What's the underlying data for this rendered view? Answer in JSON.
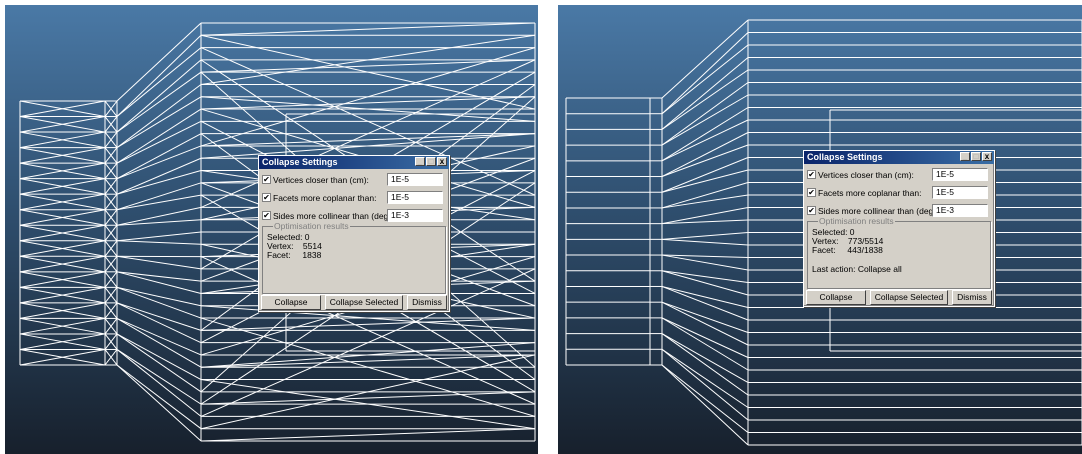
{
  "dialogs": [
    {
      "title": "Collapse Settings",
      "title_buttons": [
        "_",
        "□",
        "x"
      ],
      "options": [
        {
          "label": "Vertices closer than (cm):",
          "checked": true,
          "value": "1E-5"
        },
        {
          "label": "Facets more coplanar than:",
          "checked": true,
          "value": "1E-5"
        },
        {
          "label": "Sides more collinear than (degrees):",
          "checked": true,
          "value": "1E-3"
        }
      ],
      "results_title": "Optimisation results",
      "selected": "Selected: 0",
      "vertex": "Vertex:    5514",
      "facet": "Facet:     1838",
      "last_action": "",
      "buttons": {
        "collapse": "Collapse",
        "collapse_selected": "Collapse Selected",
        "dismiss": "Dismiss"
      }
    },
    {
      "title": "Collapse Settings",
      "title_buttons": [
        "_",
        "□",
        "x"
      ],
      "options": [
        {
          "label": "Vertices closer than (cm):",
          "checked": true,
          "value": "1E-5"
        },
        {
          "label": "Facets more coplanar than:",
          "checked": true,
          "value": "1E-5"
        },
        {
          "label": "Sides more collinear than (degrees):",
          "checked": true,
          "value": "1E-3"
        }
      ],
      "results_title": "Optimisation results",
      "selected": "Selected: 0",
      "vertex": "Vertex:    773/5514",
      "facet": "Facet:     443/1838",
      "last_action": "Last action: Collapse all",
      "buttons": {
        "collapse": "Collapse",
        "collapse_selected": "Collapse Selected",
        "dismiss": "Dismiss"
      }
    }
  ],
  "colors": {
    "viewport_top": "#4a79a6",
    "viewport_bottom": "#17202c",
    "wire": "#ffffff",
    "titlebar": "#0a246a"
  },
  "checkbox_glyph": "✔"
}
